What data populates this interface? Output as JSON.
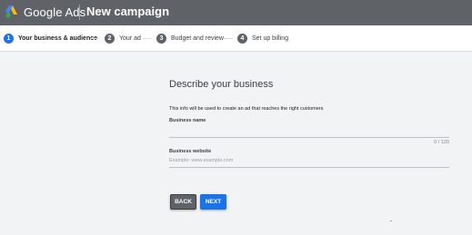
{
  "header": {
    "brand": "Google Ads",
    "title": "New campaign"
  },
  "steps": [
    {
      "number": "1",
      "label": "Your business & audience",
      "active": true
    },
    {
      "number": "2",
      "label": "Your ad",
      "active": false
    },
    {
      "number": "3",
      "label": "Budget and review",
      "active": false
    },
    {
      "number": "4",
      "label": "Set up billing",
      "active": false
    }
  ],
  "form": {
    "heading": "Describe your business",
    "intro": "This info will be used to create an ad that reaches the right customers",
    "business_name": {
      "label": "Business name",
      "value": "",
      "counter": "0 / 120"
    },
    "business_website": {
      "label": "Business website",
      "value": "",
      "placeholder": "Example: www.example.com"
    },
    "back_label": "BACK",
    "next_label": "NEXT"
  },
  "colors": {
    "header_bg": "#5f6368",
    "accent": "#1a73e8",
    "page_bg": "#f1f3f4"
  },
  "icons": {
    "logo": "google-ads-logo-icon"
  }
}
